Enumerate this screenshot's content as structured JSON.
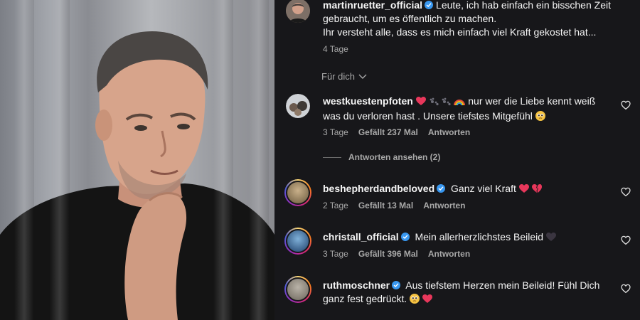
{
  "caption": {
    "username": "martinruetter_official",
    "text": "Leute, ich hab einfach ein bisschen Zeit gebraucht, um es öffentlich zu machen.",
    "text2": "Ihr versteht alle, dass es mich einfach viel Kraft gekostet hat...",
    "time": "4 Tage"
  },
  "sort": {
    "label": "Für dich"
  },
  "comments": [
    {
      "username": "westkuestenpfoten",
      "text": "nur wer die Liebe kennt weiß was du verloren hast . Unsere tiefstes Mitgefühl",
      "time": "3 Tage",
      "likes": "Gefällt 237 Mal",
      "reply": "Antworten",
      "view_replies": "Antworten ansehen (2)"
    },
    {
      "username": "beshepherdandbeloved",
      "text": "Ganz viel Kraft",
      "time": "2 Tage",
      "likes": "Gefällt 13 Mal",
      "reply": "Antworten"
    },
    {
      "username": "christall_official",
      "text": "Mein allerherzlichstes Beileid",
      "time": "3 Tage",
      "likes": "Gefällt 396 Mal",
      "reply": "Antworten"
    },
    {
      "username": "ruthmoschner",
      "text": "Aus tiefstem Herzen mein Beileid! Fühl Dich ganz fest gedrückt.",
      "time": "",
      "likes": "",
      "reply": ""
    }
  ],
  "colors": {
    "background": "#17171a",
    "verified": "#3897f0",
    "heart_emoji": "#e8375b",
    "secondary_text": "#a8a8a8"
  },
  "icons": [
    "verified-badge-icon",
    "heart-outline-icon",
    "chevron-down-icon",
    "red-heart-emoji",
    "broken-heart-emoji",
    "black-heart-emoji",
    "paw-prints-emoji",
    "rainbow-emoji",
    "pleading-face-emoji"
  ]
}
